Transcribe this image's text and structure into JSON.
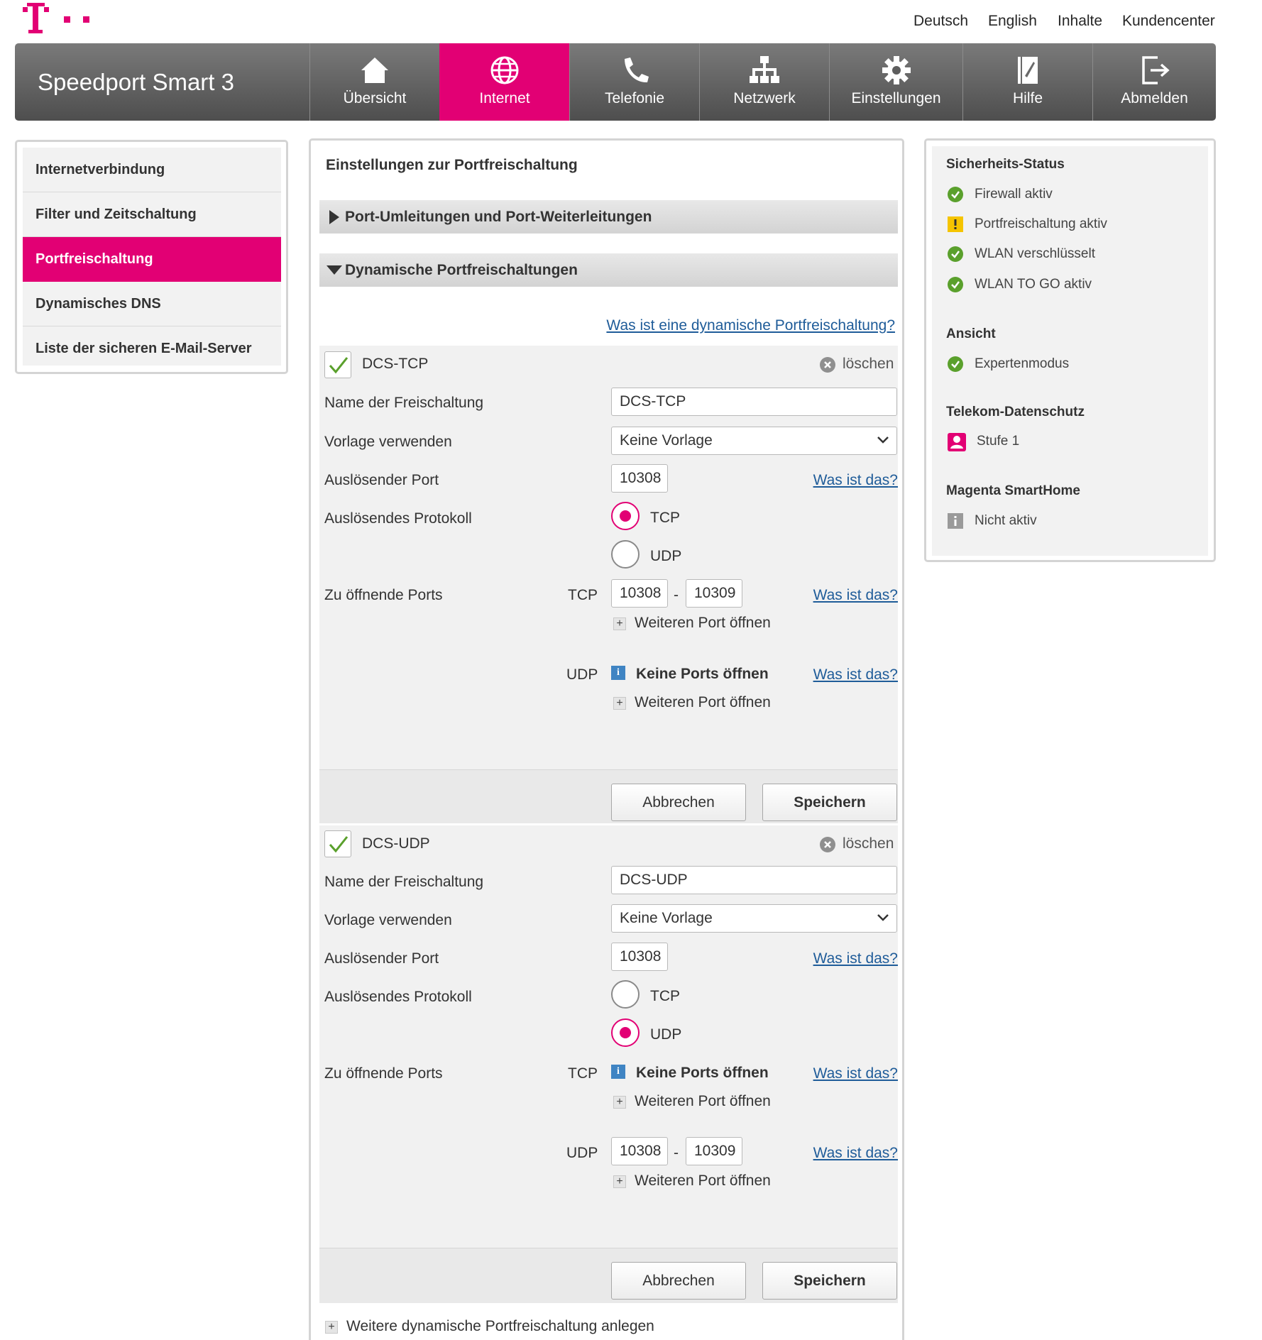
{
  "colors": {
    "accent": "#e20074",
    "link": "#1f5c99",
    "ok_green": "#5aa02c",
    "warn_yellow": "#f5c400",
    "info_blue": "#3f84c3"
  },
  "toplinks": [
    "Deutsch",
    "English",
    "Inhalte",
    "Kundencenter"
  ],
  "brand": "Speedport Smart 3",
  "nav": [
    {
      "label": "Übersicht",
      "icon": "house-icon"
    },
    {
      "label": "Internet",
      "icon": "globe-icon"
    },
    {
      "label": "Telefonie",
      "icon": "phone-icon"
    },
    {
      "label": "Netzwerk",
      "icon": "network-icon"
    },
    {
      "label": "Einstellungen",
      "icon": "gear-icon"
    },
    {
      "label": "Hilfe",
      "icon": "help-book-icon"
    },
    {
      "label": "Abmelden",
      "icon": "logout-icon"
    }
  ],
  "active_nav": "Internet",
  "sidebar": {
    "items": [
      "Internetverbindung",
      "Filter und Zeitschaltung",
      "Portfreischaltung",
      "Dynamisches DNS",
      "Liste der sicheren E-Mail-Server"
    ],
    "active": "Portfreischaltung"
  },
  "main": {
    "title": "Einstellungen zur Portfreischaltung",
    "section_collapsed": "Port-Umleitungen und Port-Weiterleitungen",
    "section_expanded": "Dynamische Portfreischaltungen",
    "help_link": "Was ist eine dynamische Portfreischaltung?",
    "labels": {
      "name": "Name der Freischaltung",
      "template": "Vorlage verwenden",
      "trigger_port": "Auslösender Port",
      "trigger_protocol": "Auslösendes Protokoll",
      "ports_to_open": "Zu öffnende Ports",
      "delete": "löschen",
      "what_is": "Was ist das?",
      "tcp": "TCP",
      "udp": "UDP",
      "no_ports": "Keine Ports öffnen",
      "more_port": "Weiteren Port öffnen",
      "range_sep": "-",
      "cancel": "Abbrechen",
      "save": "Speichern"
    },
    "entries": [
      {
        "title": "DCS-TCP",
        "checked": true,
        "name_value": "DCS-TCP",
        "template_value": "Keine Vorlage",
        "trigger_port": "10308",
        "trigger_protocol": "TCP",
        "tcp_from": "10308",
        "tcp_to": "10309"
      },
      {
        "title": "DCS-UDP",
        "checked": true,
        "name_value": "DCS-UDP",
        "template_value": "Keine Vorlage",
        "trigger_port": "10308",
        "trigger_protocol": "UDP",
        "udp_from": "10308",
        "udp_to": "10309"
      }
    ],
    "add_more": "Weitere dynamische Portfreischaltung anlegen"
  },
  "status": {
    "security_title": "Sicherheits-Status",
    "security_items": [
      {
        "label": "Firewall aktiv",
        "status": "ok"
      },
      {
        "label": "Portfreischaltung aktiv",
        "status": "warning"
      },
      {
        "label": "WLAN verschlüsselt",
        "status": "ok"
      },
      {
        "label": "WLAN TO GO aktiv",
        "status": "ok"
      }
    ],
    "view_title": "Ansicht",
    "view_item": "Expertenmodus",
    "privacy_title": "Telekom-Datenschutz",
    "privacy_item": "Stufe 1",
    "smarthome_title": "Magenta SmartHome",
    "smarthome_item": "Nicht aktiv"
  }
}
